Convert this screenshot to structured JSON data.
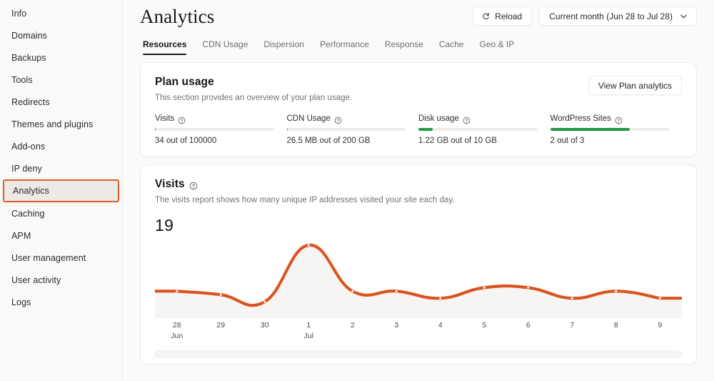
{
  "sidebar": {
    "items": [
      {
        "label": "Info",
        "active": false
      },
      {
        "label": "Domains",
        "active": false
      },
      {
        "label": "Backups",
        "active": false
      },
      {
        "label": "Tools",
        "active": false
      },
      {
        "label": "Redirects",
        "active": false
      },
      {
        "label": "Themes and plugins",
        "active": false
      },
      {
        "label": "Add-ons",
        "active": false
      },
      {
        "label": "IP deny",
        "active": false
      },
      {
        "label": "Analytics",
        "active": true
      },
      {
        "label": "Caching",
        "active": false
      },
      {
        "label": "APM",
        "active": false
      },
      {
        "label": "User management",
        "active": false
      },
      {
        "label": "User activity",
        "active": false
      },
      {
        "label": "Logs",
        "active": false
      }
    ],
    "active_highlight_color": "#e05c28"
  },
  "header": {
    "title": "Analytics",
    "reload_label": "Reload",
    "date_range_label": "Current month (Jun 28 to Jul 28)"
  },
  "tabs": [
    {
      "label": "Resources",
      "active": true
    },
    {
      "label": "CDN Usage",
      "active": false
    },
    {
      "label": "Dispersion",
      "active": false
    },
    {
      "label": "Performance",
      "active": false
    },
    {
      "label": "Response",
      "active": false
    },
    {
      "label": "Cache",
      "active": false
    },
    {
      "label": "Geo & IP",
      "active": false
    }
  ],
  "plan_usage": {
    "title": "Plan usage",
    "subtitle": "This section provides an overview of your plan usage.",
    "action_label": "View Plan analytics",
    "metrics": [
      {
        "label": "Visits",
        "value": "34 out of 100000",
        "percent": 0.8
      },
      {
        "label": "CDN Usage",
        "value": "26.5 MB out of 200 GB",
        "percent": 0.5
      },
      {
        "label": "Disk usage",
        "value": "1.22 GB out of 10 GB",
        "percent": 12.2
      },
      {
        "label": "WordPress Sites",
        "value": "2 out of 3",
        "percent": 66.7
      }
    ],
    "bar_fill_color": "#1f9c45",
    "bar_track_color": "#eeebe8"
  },
  "visits": {
    "title": "Visits",
    "subtitle": "The visits report shows how many unique IP addresses visited your site each day.",
    "total": "19"
  },
  "chart_data": {
    "type": "area",
    "title": "Visits",
    "xlabel": "",
    "ylabel": "",
    "line_color": "#d9541f",
    "fill_color": "#f7f5f4",
    "grid": false,
    "legend": "none",
    "ylim": [
      0,
      19
    ],
    "categories": [
      "28",
      "29",
      "30",
      "1",
      "2",
      "3",
      "4",
      "5",
      "6",
      "7",
      "8",
      "9"
    ],
    "month_labels": {
      "28": "Jun",
      "1": "Jul"
    },
    "x": [
      "Jun 28",
      "Jun 29",
      "Jun 30",
      "Jul 1",
      "Jul 2",
      "Jul 3",
      "Jul 4",
      "Jul 5",
      "Jul 6",
      "Jul 7",
      "Jul 8",
      "Jul 9"
    ],
    "values": [
      6,
      5,
      3,
      19,
      6,
      6,
      4,
      7,
      7,
      4,
      6,
      4
    ]
  }
}
